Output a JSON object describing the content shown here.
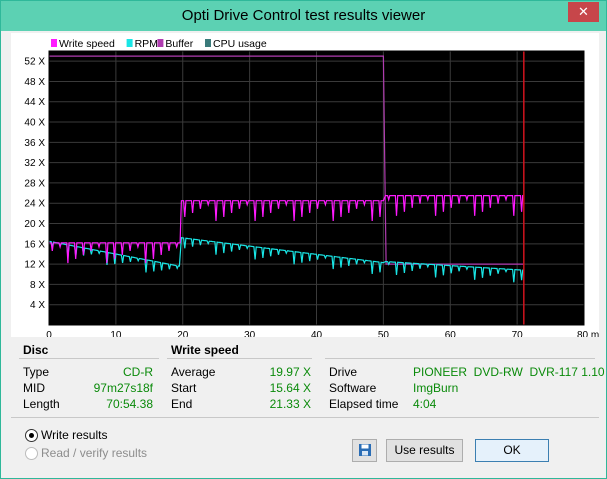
{
  "window": {
    "title": "Opti Drive Control test results viewer",
    "close_glyph": "✕"
  },
  "legend": [
    {
      "label": "Write speed",
      "color": "#ff1aff"
    },
    {
      "label": "RPM",
      "color": "#19e6e6"
    },
    {
      "label": "Buffer",
      "color": "#b03cb0"
    },
    {
      "label": "CPU usage",
      "color": "#3a7a7a"
    }
  ],
  "chart_data": {
    "type": "line",
    "xlim": [
      0,
      80
    ],
    "ylim": [
      0,
      54
    ],
    "x_ticks": [
      "0",
      "10",
      "20",
      "30",
      "40",
      "50",
      "60",
      "70",
      "80 min"
    ],
    "y_ticks": [
      "4 X",
      "8 X",
      "12 X",
      "16 X",
      "20 X",
      "24 X",
      "28 X",
      "32 X",
      "36 X",
      "40 X",
      "44 X",
      "48 X",
      "52 X"
    ],
    "grid": true,
    "end_marker_x": 71,
    "series": [
      {
        "name": "Write speed",
        "color": "#ff1aff",
        "x": [
          0,
          19.6,
          19.8,
          50,
          50.3,
          71
        ],
        "y": [
          16.2,
          16.2,
          24.5,
          24.5,
          25.5,
          25.5
        ]
      },
      {
        "name": "RPM",
        "color": "#19e6e6",
        "x": [
          0,
          19.5,
          19.8,
          50,
          50.3,
          71
        ],
        "y": [
          16.5,
          11.6,
          17.2,
          12.3,
          12.5,
          10.8
        ]
      },
      {
        "name": "Buffer",
        "color": "#b03cb0",
        "x": [
          0,
          50,
          50.4,
          71
        ],
        "y": [
          53,
          53,
          12,
          12
        ]
      }
    ]
  },
  "disc": {
    "header": "Disc",
    "rows": [
      {
        "label": "Type",
        "value": "CD-R"
      },
      {
        "label": "MID",
        "value": "97m27s18f"
      },
      {
        "label": "Length",
        "value": "70:54.38"
      }
    ]
  },
  "write_speed": {
    "header": "Write speed",
    "rows": [
      {
        "label": "Average",
        "value": "19.97 X"
      },
      {
        "label": "Start",
        "value": "15.64 X"
      },
      {
        "label": "End",
        "value": "21.33 X"
      }
    ]
  },
  "drive": {
    "rows": [
      {
        "label": "Drive",
        "value": "PIONEER  DVD-RW  DVR-117 1.10"
      },
      {
        "label": "Software",
        "value": "ImgBurn"
      },
      {
        "label": "Elapsed time",
        "value": "4:04"
      }
    ]
  },
  "options": {
    "write_results": "Write results",
    "read_verify_results": "Read / verify results"
  },
  "buttons": {
    "use_results": "Use results",
    "ok": "OK"
  }
}
